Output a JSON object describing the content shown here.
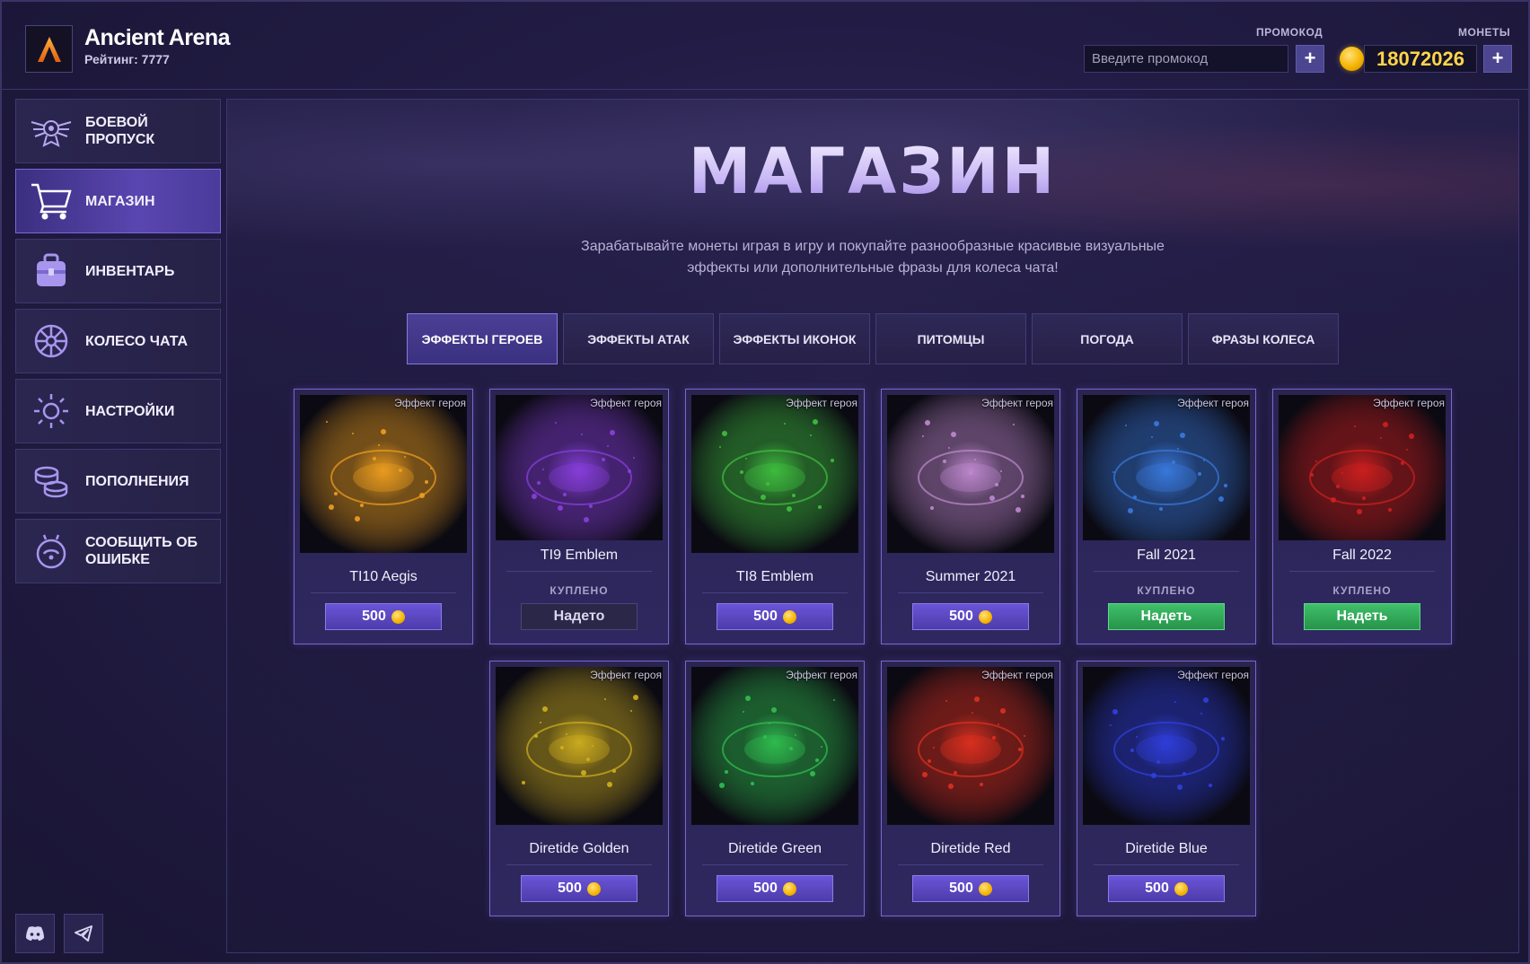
{
  "header": {
    "brand_title": "Ancient Arena",
    "rating_text": "Рейтинг: 7777",
    "promo_label": "ПРОМОКОД",
    "promo_placeholder": "Введите промокод",
    "coins_label": "МОНЕТЫ",
    "coins_value": "18072026",
    "plus_label": "+"
  },
  "sidebar": {
    "items": [
      {
        "label": "Боевой пропуск",
        "icon": "battle-pass-icon",
        "active": false
      },
      {
        "label": "Магазин",
        "icon": "cart-icon",
        "active": true
      },
      {
        "label": "Инвентарь",
        "icon": "backpack-icon",
        "active": false
      },
      {
        "label": "Колесо чата",
        "icon": "chat-wheel-icon",
        "active": false
      },
      {
        "label": "Настройки",
        "icon": "gear-icon",
        "active": false
      },
      {
        "label": "Пополнения",
        "icon": "coins-stack-icon",
        "active": false
      },
      {
        "label": "Сообщить об ошибке",
        "icon": "report-icon",
        "active": false
      }
    ],
    "social": [
      "discord-icon",
      "telegram-icon"
    ]
  },
  "main": {
    "title": "МАГАЗИН",
    "subtitle": "Зарабатывайте монеты играя в игру и покупайте разнообразные красивые визуальные эффекты или дополнительные фразы для колеса чата!",
    "tabs": [
      {
        "label": "Эффекты героев",
        "active": true
      },
      {
        "label": "Эффекты атак",
        "active": false
      },
      {
        "label": "Эффекты иконок",
        "active": false
      },
      {
        "label": "Питомцы",
        "active": false
      },
      {
        "label": "Погода",
        "active": false
      },
      {
        "label": "Фразы колеса",
        "active": false
      }
    ],
    "tag_text": "Эффект героя",
    "bought_text": "КУПЛЕНО",
    "equipped_text": "Надето",
    "equip_text": "Надеть",
    "items": [
      {
        "name": "TI10 Aegis",
        "state": "buy",
        "price": "500",
        "color": "#f0a020"
      },
      {
        "name": "TI9 Emblem",
        "state": "equipped",
        "price": "",
        "color": "#8a40e0"
      },
      {
        "name": "TI8 Emblem",
        "state": "buy",
        "price": "500",
        "color": "#40c040"
      },
      {
        "name": "Summer 2021",
        "state": "buy",
        "price": "500",
        "color": "#c08ad0"
      },
      {
        "name": "Fall 2021",
        "state": "owned",
        "price": "",
        "color": "#3a7ae0"
      },
      {
        "name": "Fall 2022",
        "state": "owned",
        "price": "",
        "color": "#d02020"
      },
      {
        "name": "Diretide Golden",
        "state": "buy",
        "price": "500",
        "color": "#d0b020"
      },
      {
        "name": "Diretide Green",
        "state": "buy",
        "price": "500",
        "color": "#30c050"
      },
      {
        "name": "Diretide Red",
        "state": "buy",
        "price": "500",
        "color": "#e03020"
      },
      {
        "name": "Diretide Blue",
        "state": "buy",
        "price": "500",
        "color": "#3040e0"
      }
    ]
  }
}
